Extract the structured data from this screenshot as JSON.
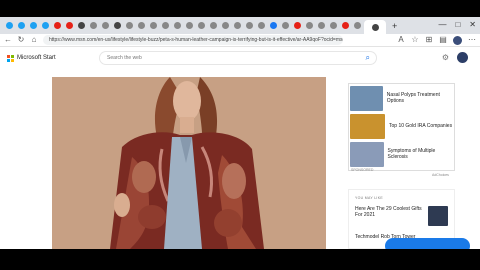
{
  "browser": {
    "tabs": [
      {
        "icon": "twitter-icon",
        "color": "#1da1f2"
      },
      {
        "icon": "twitter-icon",
        "color": "#1da1f2"
      },
      {
        "icon": "twitter-icon",
        "color": "#1da1f2"
      },
      {
        "icon": "twitter-icon",
        "color": "#1da1f2"
      },
      {
        "icon": "youtube-icon",
        "color": "#e62117"
      },
      {
        "icon": "youtube-icon",
        "color": "#e62117"
      },
      {
        "icon": "msn-icon",
        "color": "#444444"
      },
      {
        "icon": "page-icon",
        "color": "#888888"
      },
      {
        "icon": "page-icon",
        "color": "#888888"
      },
      {
        "icon": "msn-icon",
        "color": "#444444"
      },
      {
        "icon": "page-icon",
        "color": "#888888"
      },
      {
        "icon": "page-icon",
        "color": "#888888"
      },
      {
        "icon": "page-icon",
        "color": "#888888"
      },
      {
        "icon": "page-icon",
        "color": "#888888"
      },
      {
        "icon": "page-icon",
        "color": "#888888"
      },
      {
        "icon": "page-icon",
        "color": "#888888"
      },
      {
        "icon": "page-icon",
        "color": "#888888"
      },
      {
        "icon": "page-icon",
        "color": "#888888"
      },
      {
        "icon": "page-icon",
        "color": "#888888"
      },
      {
        "icon": "page-icon",
        "color": "#888888"
      },
      {
        "icon": "page-icon",
        "color": "#888888"
      },
      {
        "icon": "page-icon",
        "color": "#888888"
      },
      {
        "icon": "facebook-icon",
        "color": "#1877f2"
      },
      {
        "icon": "page-icon",
        "color": "#888888"
      },
      {
        "icon": "youtube-icon",
        "color": "#e62117"
      },
      {
        "icon": "page-icon",
        "color": "#888888"
      },
      {
        "icon": "page-icon",
        "color": "#888888"
      },
      {
        "icon": "page-icon",
        "color": "#888888"
      },
      {
        "icon": "youtube-icon",
        "color": "#e62117"
      },
      {
        "icon": "page-icon",
        "color": "#888888"
      },
      {
        "icon": "msn-icon",
        "color": "#444444",
        "active": true
      }
    ],
    "new_tab": "+",
    "window_controls": [
      "—",
      "□",
      "✕"
    ],
    "url": "https://www.msn.com/en-us/lifestyle/lifestyle-buzz/peta-s-human-leather-campaign-is-terrifying-but-is-it-effective/ar-AA9qoF?ocid=msedgntp"
  },
  "header": {
    "brand": "Microsoft Start",
    "search_placeholder": "Search the web",
    "logo_colors": [
      "#f25022",
      "#7fba00",
      "#00a4ef",
      "#ffb900"
    ]
  },
  "ads": {
    "items": [
      {
        "text": "Nasal Polyps Treatment Options",
        "thumb_color": "#6f8fb0"
      },
      {
        "text": "Top 10 Gold IRA Companies",
        "thumb_color": "#c9922e"
      },
      {
        "text": "Symptoms of Multiple Sclerosis",
        "thumb_color": "#8a9bb8"
      }
    ],
    "sponsored_label": "SPONSORED",
    "adchoices_label": "AdChoices"
  },
  "may_like": {
    "heading": "YOU MAY LIKE",
    "item1": "Here Are The 29 Coolest Gifts For 2021",
    "item2": "Techmodel Rob Torn Tower"
  }
}
